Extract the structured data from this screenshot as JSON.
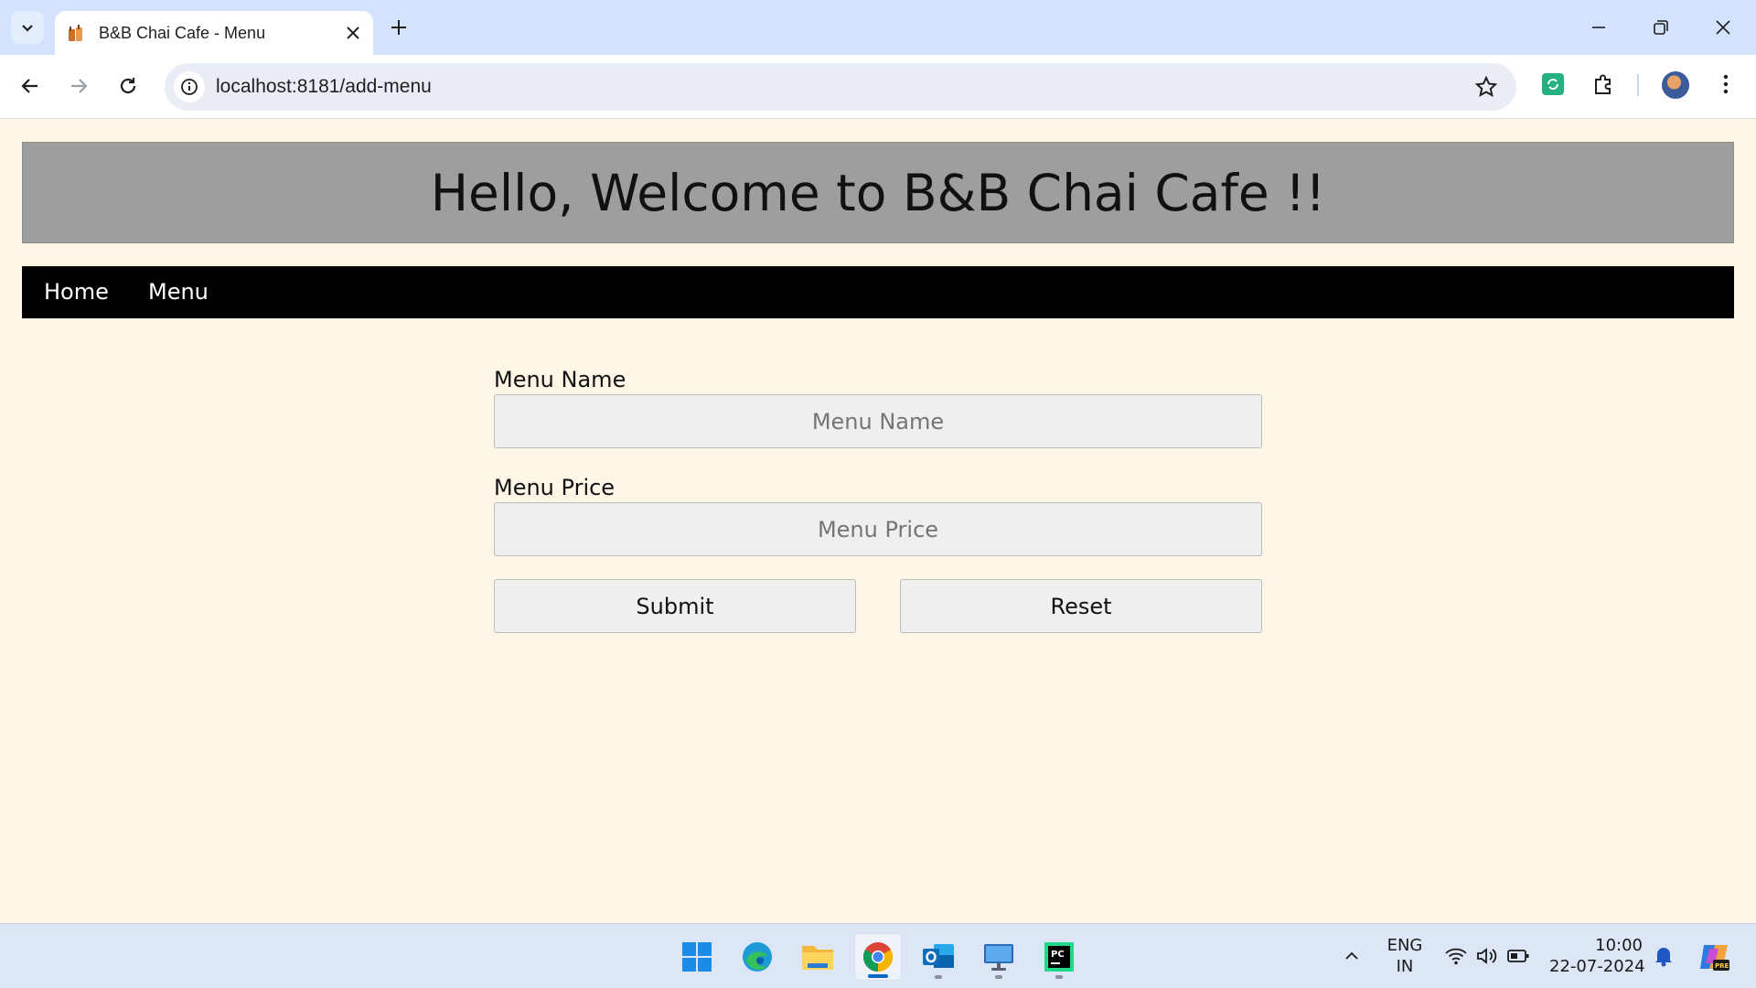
{
  "browser": {
    "tab_title": "B&B Chai Cafe - Menu",
    "url": "localhost:8181/add-menu"
  },
  "page": {
    "banner_title": "Hello, Welcome to B&B Chai Cafe !!",
    "nav": [
      {
        "label": "Home"
      },
      {
        "label": "Menu"
      }
    ],
    "form": {
      "name_label": "Menu Name",
      "name_placeholder": "Menu Name",
      "price_label": "Menu Price",
      "price_placeholder": "Menu Price",
      "submit_label": "Submit",
      "reset_label": "Reset"
    }
  },
  "taskbar": {
    "lang_top": "ENG",
    "lang_bottom": "IN",
    "time": "10:00",
    "date": "22-07-2024",
    "apps": [
      "windows-start",
      "edge",
      "file-explorer",
      "chrome",
      "outlook",
      "remote-desktop",
      "pycharm"
    ]
  },
  "colors": {
    "page_bg": "#fdf5e6",
    "banner_bg": "#9e9e9e",
    "navbar_bg": "#000000",
    "tabbar_bg": "#d3e3fd"
  }
}
